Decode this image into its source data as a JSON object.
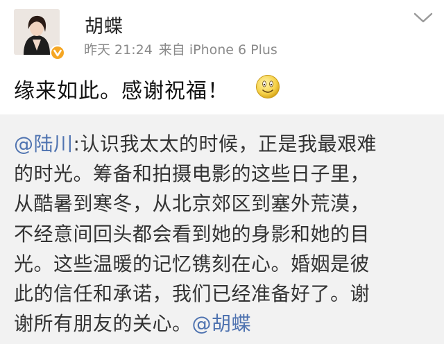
{
  "post": {
    "username": "胡蝶",
    "time": "昨天 21:24",
    "source": "来自 iPhone 6 Plus",
    "text": "缘来如此。感谢祝福！",
    "emoji": "smile-emoji-icon"
  },
  "repost": {
    "mention_author": "@陆川",
    "lines": [
      ":认识我太太的时候，正是我最艰难",
      "的时光。筹备和拍摄电影的这些日子里，",
      "从酷暑到寒冬，从北京郊区到塞外荒漠，",
      "不经意间回头都会看到她的身影和她的目",
      "光。这些温暖的记忆镌刻在心。婚姻是彼",
      "此的信任和承诺，我们已经准备好了。谢",
      "谢所有朋友的关心。"
    ],
    "mention_end": "@胡蝶"
  },
  "colors": {
    "mention": "#4f73b0",
    "verified_badge": "#f5a623",
    "repost_background": "#f2f2f2",
    "meta_text": "#8a8a8a"
  }
}
